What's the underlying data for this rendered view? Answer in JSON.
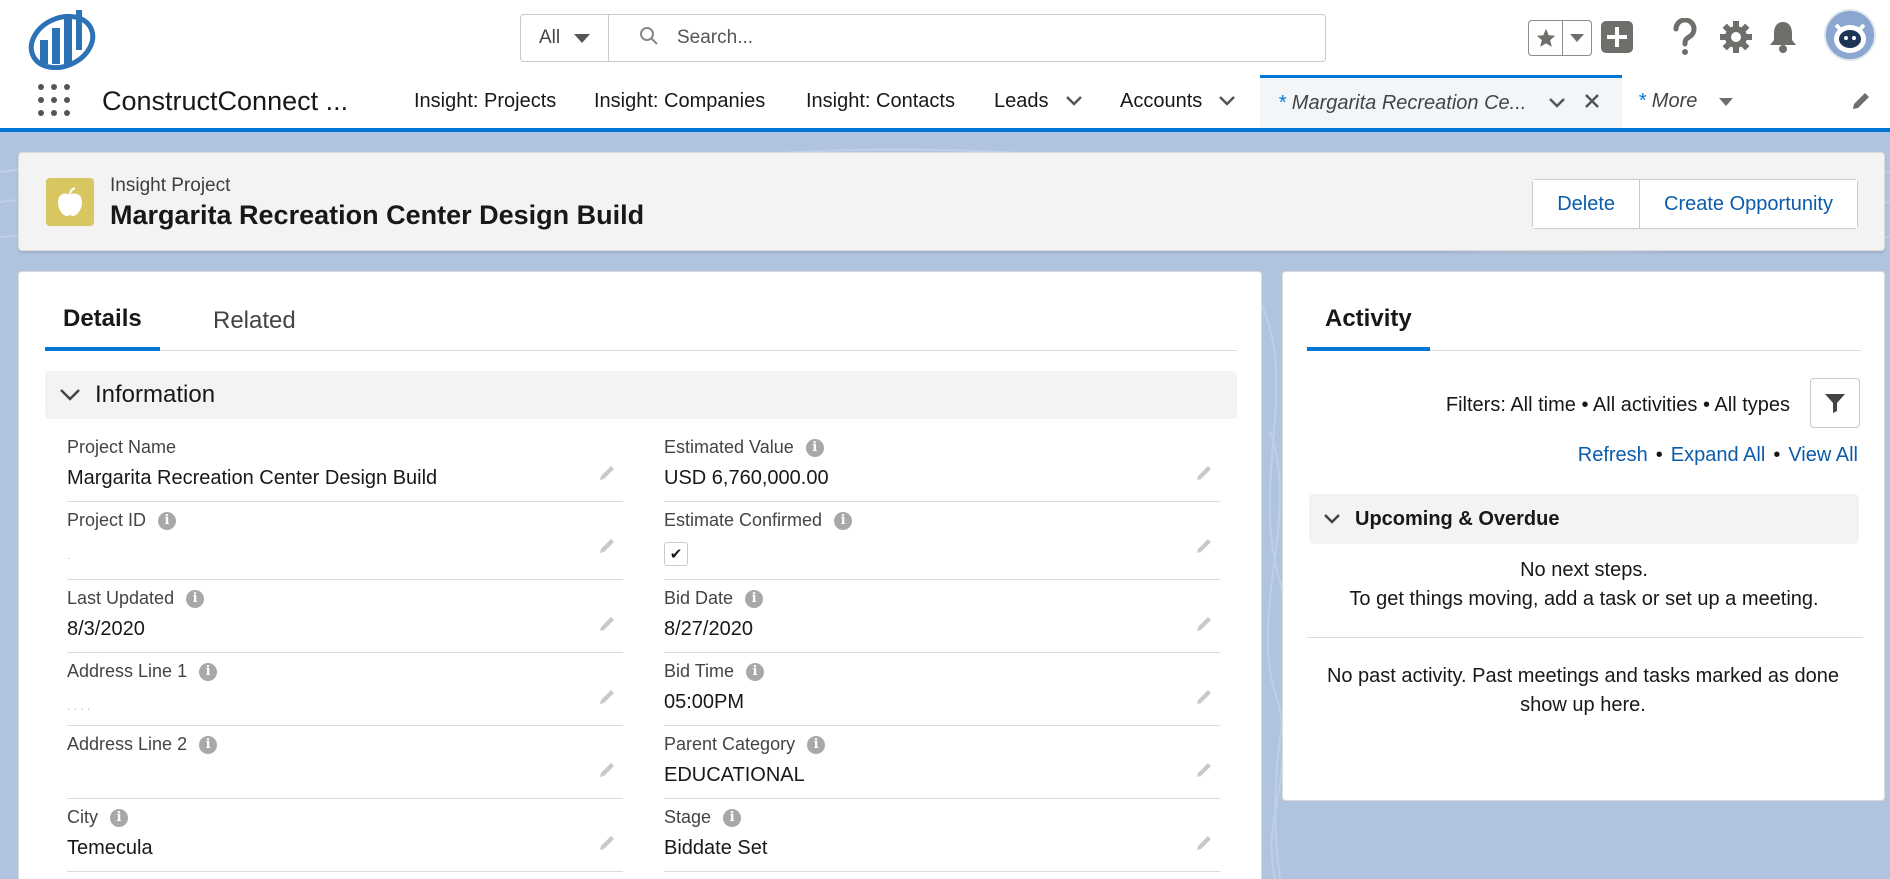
{
  "header": {
    "search_scope": "All",
    "search_placeholder": "Search..."
  },
  "nav": {
    "app_name": "ConstructConnect ...",
    "items": [
      {
        "label": "Insight: Projects"
      },
      {
        "label": "Insight: Companies"
      },
      {
        "label": "Insight: Contacts"
      },
      {
        "label": "Leads"
      },
      {
        "label": "Accounts"
      }
    ],
    "active_tab": {
      "marker": "*",
      "label": "Margarita Recreation Ce..."
    },
    "more": {
      "marker": "*",
      "label": "More"
    }
  },
  "record": {
    "object_type": "Insight Project",
    "title": "Margarita Recreation Center Design Build",
    "actions": {
      "delete": "Delete",
      "create_opportunity": "Create Opportunity"
    }
  },
  "tabs": {
    "details": "Details",
    "related": "Related"
  },
  "section": {
    "title": "Information"
  },
  "fields": {
    "project_name": {
      "label": "Project Name",
      "value": "Margarita Recreation Center Design Build"
    },
    "estimated_value": {
      "label": "Estimated Value",
      "value": "USD 6,760,000.00"
    },
    "project_id": {
      "label": "Project ID",
      "value": "."
    },
    "estimate_confirmed": {
      "label": "Estimate Confirmed",
      "checked": true
    },
    "last_updated": {
      "label": "Last Updated",
      "value": "8/3/2020"
    },
    "bid_date": {
      "label": "Bid Date",
      "value": "8/27/2020"
    },
    "address_line_1": {
      "label": "Address Line 1",
      "value": ". .  .  ."
    },
    "bid_time": {
      "label": "Bid Time",
      "value": "05:00PM"
    },
    "address_line_2": {
      "label": "Address Line 2",
      "value": ""
    },
    "parent_category": {
      "label": "Parent Category",
      "value": "EDUCATIONAL"
    },
    "city": {
      "label": "City",
      "value": "Temecula"
    },
    "stage": {
      "label": "Stage",
      "value": "Biddate Set"
    }
  },
  "activity": {
    "tab": "Activity",
    "filters": "Filters: All time • All activities • All types",
    "links": {
      "refresh": "Refresh",
      "expand_all": "Expand All",
      "view_all": "View All",
      "sep": "•"
    },
    "upcoming_title": "Upcoming & Overdue",
    "no_next_line1": "No next steps.",
    "no_next_line2": "To get things moving, add a task or set up a meeting.",
    "no_past_line1": "No past activity. Past meetings and tasks marked as done",
    "no_past_line2": "show up here."
  },
  "colors": {
    "brand": "#0176d3",
    "link": "#0b5cab",
    "object_icon": "#d8c760",
    "background": "#b0c4df"
  }
}
